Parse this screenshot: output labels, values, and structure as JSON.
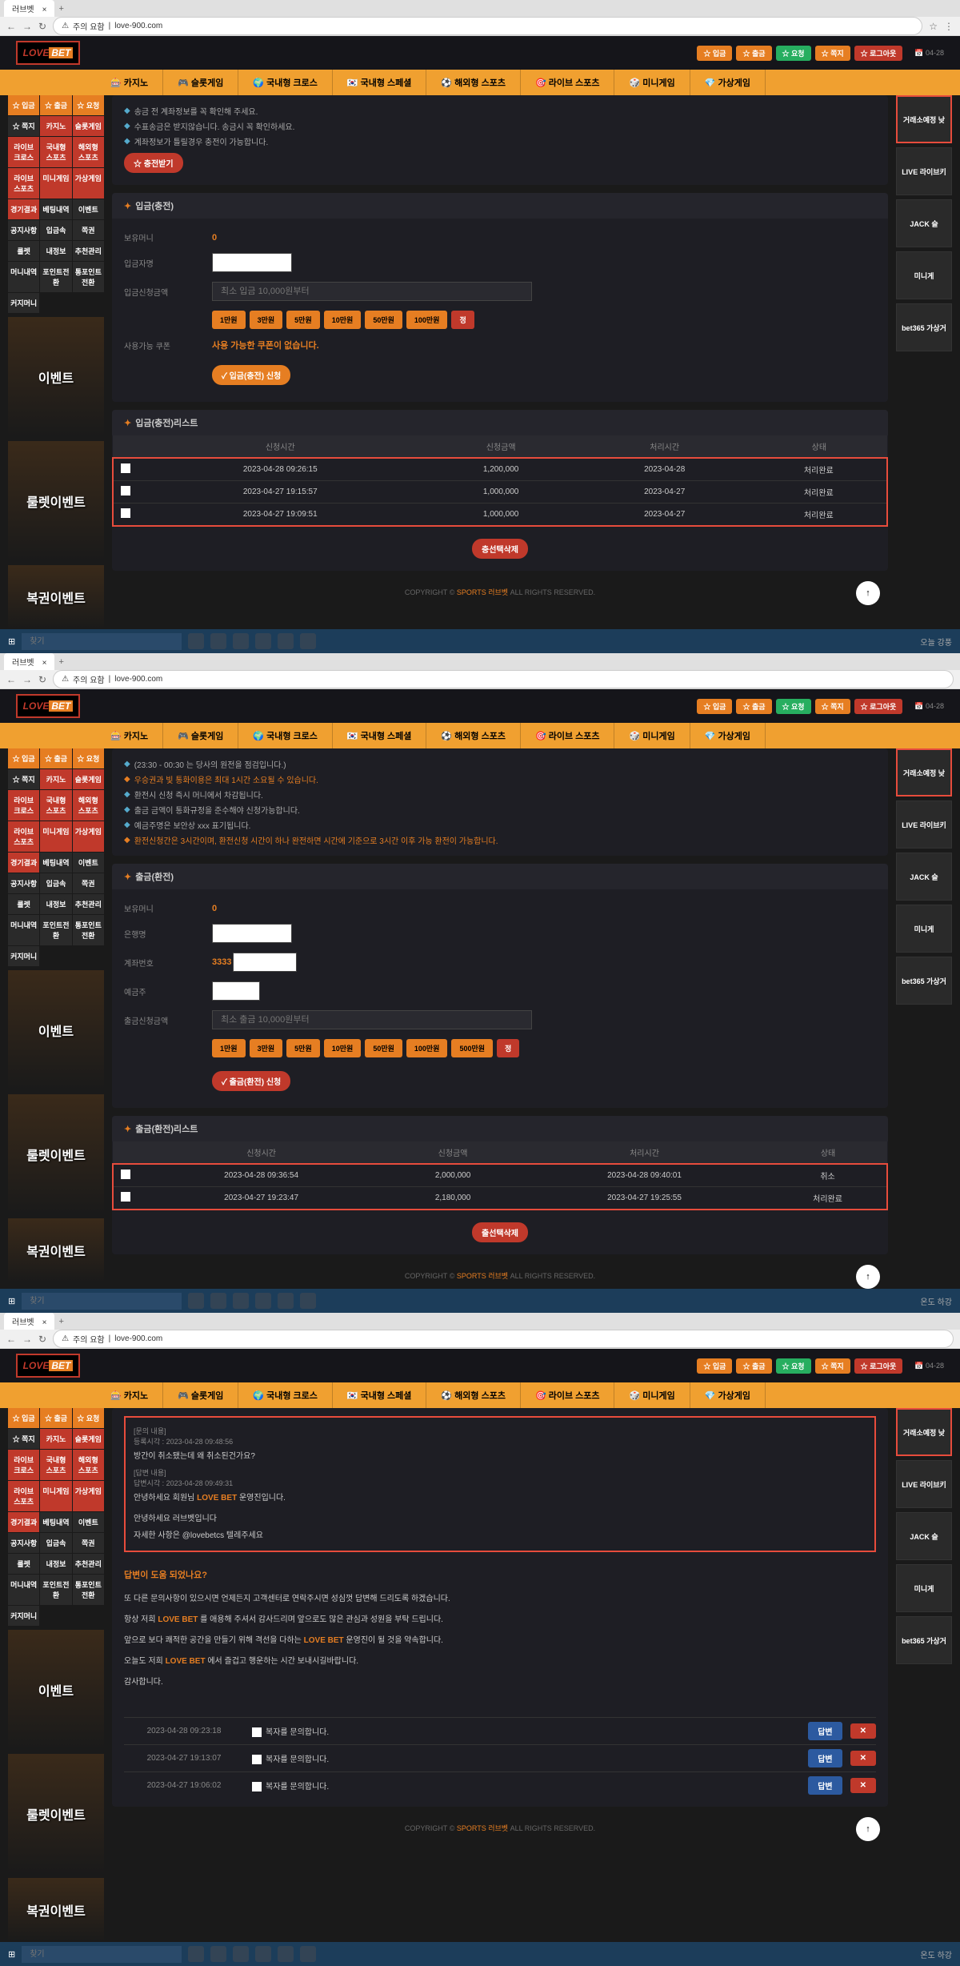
{
  "browser": {
    "tab_title": "러브벳",
    "url": "love-900.com",
    "security": "주의 요함"
  },
  "header": {
    "logo_love": "LOVE",
    "logo_bet": "BET",
    "btn_deposit": "☆ 입금",
    "btn_withdraw": "☆ 출금",
    "btn_money": "☆ 요청",
    "btn_point": "☆ 쪽지",
    "btn_logout": "☆ 로그아웃",
    "date": "📅 04-28"
  },
  "nav": {
    "items": [
      "🎰 카지노",
      "🎮 슬롯게임",
      "🌍 국내형 크로스",
      "🇰🇷 국내형 스페셜",
      "⚽ 해외형 스포츠",
      "🎯 라이브 스포츠",
      "🎲 미니게임",
      "💎 가상게임"
    ]
  },
  "sidebar": {
    "top": [
      {
        "txt": "☆ 입금",
        "cls": "orange"
      },
      {
        "txt": "☆ 출금",
        "cls": "orange"
      },
      {
        "txt": "☆ 요청",
        "cls": "orange"
      },
      {
        "txt": "☆ 쪽지",
        "cls": "dark"
      },
      {
        "txt": "카지노",
        "cls": "red"
      },
      {
        "txt": "슬롯게임",
        "cls": "red"
      },
      {
        "txt": "라이브 크로스",
        "cls": "red"
      },
      {
        "txt": "국내형 스포츠",
        "cls": "red"
      },
      {
        "txt": "해외형 스포츠",
        "cls": "red"
      },
      {
        "txt": "라이브 스포츠",
        "cls": "red"
      },
      {
        "txt": "미니게임",
        "cls": "red"
      },
      {
        "txt": "가상게임",
        "cls": "red"
      },
      {
        "txt": "경기결과",
        "cls": "red"
      },
      {
        "txt": "베팅내역",
        "cls": "dark"
      },
      {
        "txt": "이벤트",
        "cls": "dark"
      },
      {
        "txt": "공지사항",
        "cls": "dark"
      },
      {
        "txt": "입금속",
        "cls": "dark"
      },
      {
        "txt": "쪽권",
        "cls": "dark"
      },
      {
        "txt": "룰렛",
        "cls": "dark"
      },
      {
        "txt": "내정보",
        "cls": "dark"
      },
      {
        "txt": "추천관리",
        "cls": "dark"
      },
      {
        "txt": "머니내역",
        "cls": "dark"
      },
      {
        "txt": "포인트전환",
        "cls": "dark"
      },
      {
        "txt": "통포인트전환",
        "cls": "dark"
      },
      {
        "txt": "커지머니",
        "cls": "dark"
      }
    ],
    "banner1": "이벤트",
    "banner2": "룰렛이벤트",
    "banner3": "복권이벤트"
  },
  "rightcol": {
    "items": [
      {
        "txt": "거래소예정 낮",
        "cls": "highlight"
      },
      {
        "txt": "LIVE 라이브키"
      },
      {
        "txt": "JACK 슬"
      },
      {
        "txt": "미니게"
      },
      {
        "txt": "bet365 가상거"
      }
    ]
  },
  "deposit": {
    "notices": [
      "송금 전 계좌정보를 꼭 확인해 주세요.",
      "수표송금은 받지않습니다. 송금시 꼭 확인하세요.",
      "계좌정보가 틀릴경우 충전이 가능합니다."
    ],
    "apply_btn": "☆ 충전받기",
    "title": "입금(충전)",
    "label_balance": "보유머니",
    "val_balance": "0",
    "label_name": "입금자명",
    "label_amount": "입금신청금액",
    "placeholder_amount": "최소 입금 10,000원부터",
    "amounts": [
      "1만원",
      "3만원",
      "5만원",
      "10만원",
      "50만원",
      "100만원"
    ],
    "reset": "정",
    "label_coupon": "사용가능 쿠폰",
    "coupon_msg": "사용 가능한 쿠폰이 없습니다.",
    "submit_btn": "✓ 입금(충전) 신청",
    "list_title": "입금(충전)리스트",
    "cols": [
      "",
      "신청시간",
      "신청금액",
      "처리시간",
      "상태"
    ],
    "rows": [
      {
        "date": "2023-04-28 09:26:15",
        "amt": "1,200,000",
        "proc": "2023-04-28",
        "status": "처리완료"
      },
      {
        "date": "2023-04-27 19:15:57",
        "amt": "1,000,000",
        "proc": "2023-04-27",
        "status": "처리완료"
      },
      {
        "date": "2023-04-27 19:09:51",
        "amt": "1,000,000",
        "proc": "2023-04-27",
        "status": "처리완료"
      }
    ],
    "del_btn": "충선택삭제"
  },
  "withdraw": {
    "notices": [
      "(23:30 - 00:30 는 당사의 원전을 점검입니다.)",
      "우승권과 빛 통화이용은 최대 1시간 소요될 수 있습니다.",
      "환전시 신청 즉시 머니에서 차감됩니다.",
      "출금 금액이 통화규정을 준수해야 신청가능합니다.",
      "예금주명은 보안상 xxx 표기됩니다.",
      "환전신청간은 3시간이며, 환전신청 시간이 하나 완전하면 시간에 기준으로 3시간 이후 가능 환전이 가능합니다."
    ],
    "title": "출금(환전)",
    "label_balance": "보유머니",
    "val_balance": "0",
    "label_bank": "은행명",
    "label_account": "계좌번호",
    "val_account": "3333",
    "label_holder": "예금주",
    "label_amount": "출금신청금액",
    "placeholder_amount": "최소 출금 10,000원부터",
    "amounts": [
      "1만원",
      "3만원",
      "5만원",
      "10만원",
      "50만원",
      "100만원",
      "500만원"
    ],
    "reset": "정",
    "submit_btn": "✓ 출금(환전) 신청",
    "list_title": "출금(환전)리스트",
    "cols": [
      "",
      "신청시간",
      "신청금액",
      "처리시간",
      "상태"
    ],
    "rows": [
      {
        "date": "2023-04-28 09:36:54",
        "amt": "2,000,000",
        "proc": "2023-04-28 09:40:01",
        "status": "취소"
      },
      {
        "date": "2023-04-27 19:23:47",
        "amt": "2,180,000",
        "proc": "2023-04-27 19:25:55",
        "status": "처리완료"
      }
    ],
    "del_btn": "출선택삭제"
  },
  "inquiry": {
    "q_title": "[문의 내용]",
    "q_time": "등록시각 : 2023-04-28 09:48:56",
    "q_body": "방간이 취소됐는데 왜 취소된건가요?",
    "a_title": "[답변 내용]",
    "a_time": "답변시각 : 2023-04-28 09:49:31",
    "a_body1": "안녕하세요 회원님 ",
    "a_brand": "LOVE BET",
    "a_body2": " 운영진입니다.",
    "a_body3": "안녕하세요 러브벳입니다",
    "a_body4": "자세한 사항은 @lovebetcs 텔레주세요",
    "help_title": "답변이 도움 되었나요?",
    "help_l1": "또 다른 문의사항이 있으시면 언제든지 고객센터로 연락주시면 성심껏 답변해 드리도록 하겠습니다.",
    "help_l2_a": "항상 저희 ",
    "help_l2_b": " 를 애용해 주셔서 감사드리며 앞으로도 많은 관심과 성원을 부탁 드립니다.",
    "help_l3_a": "앞으로 보다 쾌적한 공간을 만들기 위해 격선을 다하는 ",
    "help_l3_b": " 운영진이 될 것을 약속합니다.",
    "help_l4_a": "오늘도 저희 ",
    "help_l4_b": " 에서 즐겁고 행운하는 시간 보내시길바랍니다.",
    "help_l5": "감사합니다.",
    "ratings": [
      {
        "date": "2023-04-28 09:23:18",
        "txt": "복자를 문의합니다.",
        "btn1": "답변",
        "btn2": "✕"
      },
      {
        "date": "2023-04-27 19:13:07",
        "txt": "복자를 문의합니다.",
        "btn1": "답변",
        "btn2": "✕"
      },
      {
        "date": "2023-04-27 19:06:02",
        "txt": "복자를 문의합니다.",
        "btn1": "답변",
        "btn2": "✕"
      }
    ]
  },
  "footer": {
    "copy": "COPYRIGHT © ",
    "brand": "SPORTS 러브벳",
    "rights": " ALL RIGHTS RESERVED."
  },
  "taskbar": {
    "search": "찾기",
    "weather1": "오늘 강풍",
    "weather2": "온도 하강"
  }
}
